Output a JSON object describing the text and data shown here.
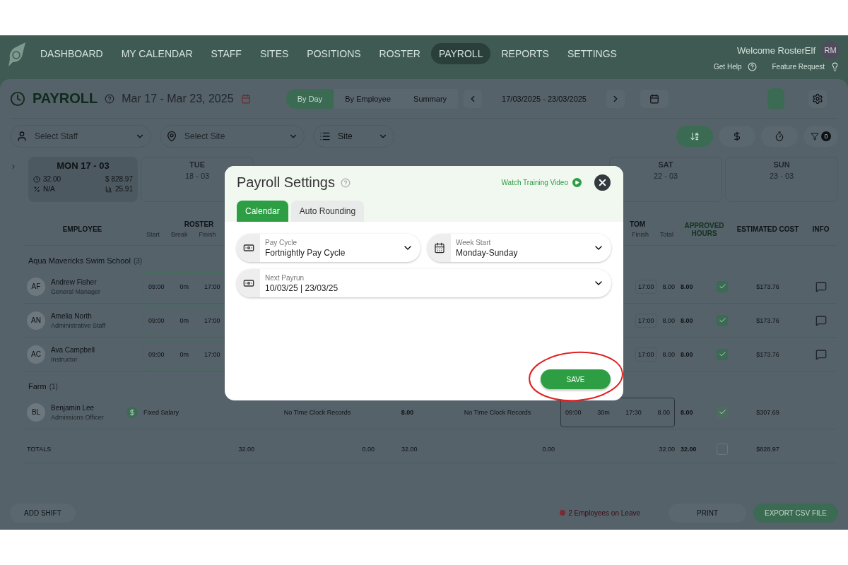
{
  "nav": {
    "items": [
      {
        "label": "DASHBOARD",
        "selected": false
      },
      {
        "label": "MY CALENDAR",
        "selected": false
      },
      {
        "label": "STAFF",
        "selected": false
      },
      {
        "label": "SITES",
        "selected": false
      },
      {
        "label": "POSITIONS",
        "selected": false
      },
      {
        "label": "ROSTER",
        "selected": false
      },
      {
        "label": "PAYROLL",
        "selected": true
      },
      {
        "label": "REPORTS",
        "selected": false
      },
      {
        "label": "SETTINGS",
        "selected": false
      }
    ],
    "welcome": "Welcome RosterElf",
    "avatar": "RM",
    "help": "Get Help",
    "feature": "Feature Request"
  },
  "toolbar": {
    "title": "PAYROLL",
    "date_range": "Mar 17 - Mar 23, 2025",
    "views": [
      {
        "label": "By Day",
        "selected": true
      },
      {
        "label": "By Employee",
        "selected": false
      },
      {
        "label": "Summary",
        "selected": false
      }
    ],
    "period": "17/03/2025 - 23/03/2025"
  },
  "filters": {
    "staff_placeholder": "Select Staff",
    "site_placeholder": "Select Site",
    "group_by": "Site",
    "sort_buttons": [
      {
        "kind": "alpha",
        "selected": true
      },
      {
        "kind": "cost",
        "selected": false
      },
      {
        "kind": "time",
        "selected": false
      }
    ],
    "filter_count": "0"
  },
  "days": [
    {
      "day": "MON 17 - 03",
      "selected": true,
      "hours": "32.00",
      "cost": "$ 828.97",
      "percent": "N/A",
      "rate": "25.91"
    },
    {
      "day": "TUE",
      "date": "18 - 03",
      "selected": false
    },
    {
      "day": "SAT",
      "date": "22 - 03",
      "selected": false
    },
    {
      "day": "SUN",
      "date": "23 - 03",
      "selected": false
    }
  ],
  "table": {
    "headers": {
      "employee": "EMPLOYEE",
      "roster": "ROSTER",
      "roster_sub": [
        "Start",
        "Break",
        "Finish"
      ],
      "custom": "TOM",
      "custom_sub": [
        "Finish",
        "Total"
      ],
      "approved": "APPROVED HOURS",
      "estimated": "ESTIMATED COST",
      "info": "INFO"
    },
    "groups": [
      {
        "name": "Aqua Mavericks Swim School",
        "count": "(3)",
        "rows": [
          {
            "kind": "shift",
            "initials": "AF",
            "name": "Andrew Fisher",
            "role": "General Manager",
            "roster": [
              "09:00",
              "0m",
              "17:00"
            ],
            "custom": [
              "17:00",
              "8.00"
            ],
            "approved": "8.00",
            "checked": true,
            "disabled": false,
            "cost": "$173.76",
            "note": true
          },
          {
            "kind": "shift",
            "initials": "AN",
            "name": "Amelia North",
            "role": "Administrative Staff",
            "roster": [
              "09:00",
              "0m",
              "17:00"
            ],
            "custom": [
              "17:00",
              "8.00"
            ],
            "approved": "8.00",
            "checked": true,
            "disabled": false,
            "cost": "$173.76",
            "note": true
          },
          {
            "kind": "shift",
            "initials": "AC",
            "name": "Ava Campbell",
            "role": "Instructor",
            "roster": [
              "09:00",
              "0m",
              "17:00"
            ],
            "custom": [
              "17:00",
              "8.00"
            ],
            "approved": "8.00",
            "checked": true,
            "disabled": false,
            "cost": "$173.76",
            "note": true
          }
        ]
      },
      {
        "name": "Farm",
        "count": "(1)",
        "rows": [
          {
            "kind": "salary",
            "initials": "BL",
            "name": "Benjamin Lee",
            "role": "Admissions Officer",
            "roster_note": "Fixed Salary",
            "timeclock": "No Time Clock Records",
            "hours": "8.00",
            "timeclock2": "No Time Clock Records",
            "custom": [
              "09:00",
              "30m",
              "17:30",
              "8.00"
            ],
            "approved": "8.00",
            "checked": true,
            "disabled": true,
            "cost": "$307.69",
            "note": false
          }
        ]
      }
    ],
    "totals": {
      "label": "TOTALS",
      "roster": "32.00",
      "timeclock": "0.00",
      "hours": "32.00",
      "timeclock2": "0.00",
      "custom": "32.00",
      "approved": "32.00",
      "checked": false,
      "cost": "$828.97"
    }
  },
  "footer": {
    "add_shift": "ADD SHIFT",
    "leave": "2 Employees on Leave",
    "print": "PRINT",
    "export": "EXPORT CSV FILE"
  },
  "modal": {
    "title": "Payroll Settings",
    "video_link": "Watch Training Video",
    "tabs": [
      {
        "label": "Calendar",
        "selected": true
      },
      {
        "label": "Auto Rounding",
        "selected": false
      }
    ],
    "fields": [
      {
        "kind": "money",
        "label": "Pay Cycle",
        "value": "Fortnightly Pay Cycle",
        "wide": false
      },
      {
        "kind": "calendar",
        "label": "Week Start",
        "value": "Monday-Sunday",
        "wide": false
      },
      {
        "kind": "money",
        "label": "Next Payrun",
        "value": "10/03/25 | 23/03/25",
        "wide": true
      }
    ],
    "save": "SAVE"
  }
}
